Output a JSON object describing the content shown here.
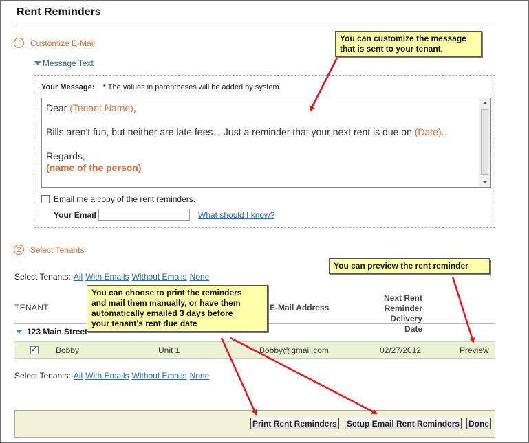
{
  "page": {
    "title": "Rent Reminders"
  },
  "step1": {
    "number": "1",
    "label": "Customize E-Mail"
  },
  "message_toggle": {
    "label": "Message Text"
  },
  "your_message": {
    "label": "Your Message:",
    "note": "* The values in parentheses will be added by system."
  },
  "message_body": {
    "greeting_prefix": "Dear ",
    "greeting_token": "(Tenant Name)",
    "greeting_suffix": ",",
    "body_prefix": "Bills aren't fun, but neither are late fees... Just a reminder that your next rent is due on ",
    "body_token": "(Date)",
    "body_suffix": ".",
    "closing": "Regards,",
    "signature_token": "(name of the person)"
  },
  "copy_option": {
    "label": "Email me a copy of the rent reminders.",
    "checked": false
  },
  "your_email": {
    "label": "Your Email",
    "value": "",
    "help_link": "What should I know?"
  },
  "step2": {
    "number": "2",
    "label": "Select Tenants"
  },
  "filters": {
    "label": "Select Tenants:",
    "all": "All",
    "with_emails": "With Emails",
    "without_emails": "Without Emails",
    "none": "None"
  },
  "table": {
    "headers": {
      "tenant": "TENANT",
      "email": "E-Mail Address",
      "next1": "Next Rent",
      "next2": "Reminder",
      "next3": "Delivery Date"
    },
    "group": "123 Main Street",
    "rows": [
      {
        "checked": true,
        "name": "Bobby",
        "unit": "Unit 1",
        "email": "Bobby@gmail.com",
        "date": "02/27/2012",
        "action": "Preview"
      }
    ]
  },
  "buttons": {
    "print": "Print Rent Reminders",
    "setup": "Setup Email Rent Reminders",
    "done": "Done"
  },
  "callouts": {
    "customize": {
      "line1": "You can customize the message",
      "line2": "that is sent to your tenant."
    },
    "preview": {
      "line1": "You can preview the rent reminder"
    },
    "print": {
      "line1": "You can choose to print the reminders",
      "line2": "and mail them manually, or have them",
      "line3": "automatically emailed 3 days before",
      "line4": "your tenant's rent due date"
    }
  },
  "colors": {
    "accent": "#e06a35",
    "link": "#2a68b0",
    "callout_bg": "#ffffaa",
    "row_bg": "#ecf2d4",
    "arrow": "#e8141a"
  }
}
